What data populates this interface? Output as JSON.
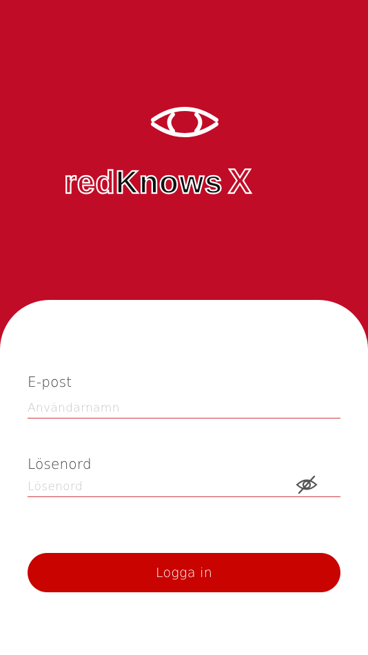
{
  "brand": {
    "name_part1": "red",
    "name_part2": "Knows",
    "name_part3": "X"
  },
  "form": {
    "email": {
      "label": "E-post",
      "placeholder": "Användarnamn",
      "value": ""
    },
    "password": {
      "label": "Lösenord",
      "placeholder": "Lösenord",
      "value": ""
    },
    "password_toggle_icon": "eye-slash-icon",
    "submit_label": "Logga in"
  },
  "colors": {
    "header_bg": "#c10c27",
    "button_bg": "#c80300",
    "input_underline": "#d13a45"
  }
}
